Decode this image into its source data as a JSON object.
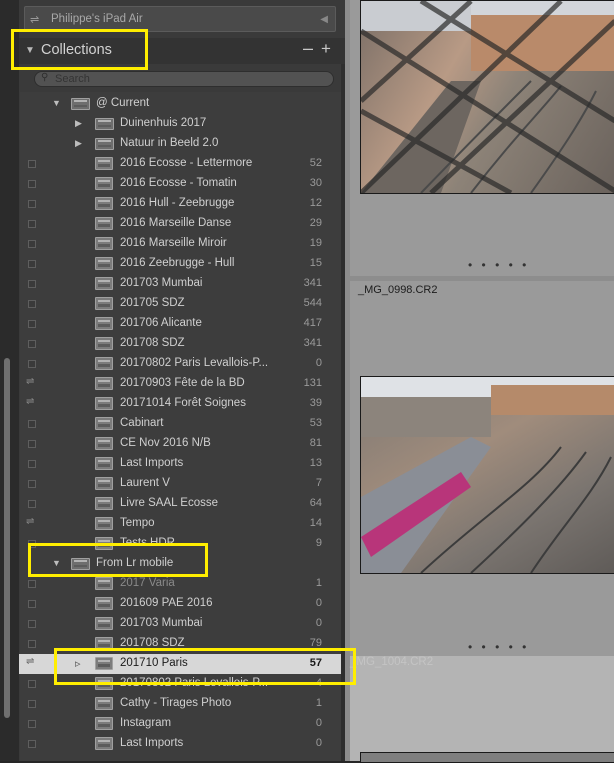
{
  "device": {
    "name": "Philippe's iPad Air"
  },
  "collections_panel": {
    "title": "Collections",
    "search_placeholder": "Search",
    "rows": [
      {
        "label": "@ Current",
        "count": "",
        "type": "set-open",
        "depth": 0
      },
      {
        "label": "Duinenhuis 2017",
        "count": "",
        "type": "set-closed",
        "depth": 1
      },
      {
        "label": "Natuur in Beeld 2.0",
        "count": "",
        "type": "set-closed",
        "depth": 1
      },
      {
        "label": "2016 Ecosse - Lettermore",
        "count": "52",
        "type": "coll",
        "depth": 1
      },
      {
        "label": "2016 Ecosse - Tomatin",
        "count": "30",
        "type": "coll",
        "depth": 1
      },
      {
        "label": "2016 Hull - Zeebrugge",
        "count": "12",
        "type": "coll",
        "depth": 1
      },
      {
        "label": "2016 Marseille Danse",
        "count": "29",
        "type": "coll",
        "depth": 1
      },
      {
        "label": "2016 Marseille Miroir",
        "count": "19",
        "type": "coll",
        "depth": 1
      },
      {
        "label": "2016 Zeebrugge - Hull",
        "count": "15",
        "type": "coll",
        "depth": 1
      },
      {
        "label": "201703 Mumbai",
        "count": "341",
        "type": "coll",
        "depth": 1
      },
      {
        "label": "201705 SDZ",
        "count": "544",
        "type": "coll",
        "depth": 1
      },
      {
        "label": "201706 Alicante",
        "count": "417",
        "type": "coll",
        "depth": 1
      },
      {
        "label": "201708 SDZ",
        "count": "341",
        "type": "coll",
        "depth": 1
      },
      {
        "label": "20170802 Paris Levallois-P...",
        "count": "0",
        "type": "coll",
        "depth": 1
      },
      {
        "label": "20170903 Fête de la BD",
        "count": "131",
        "type": "coll-sync",
        "depth": 1
      },
      {
        "label": "20171014 Forêt Soignes",
        "count": "39",
        "type": "coll-sync",
        "depth": 1
      },
      {
        "label": "Cabinart",
        "count": "53",
        "type": "coll",
        "depth": 1
      },
      {
        "label": "CE Nov 2016 N/B",
        "count": "81",
        "type": "coll",
        "depth": 1
      },
      {
        "label": "Last Imports",
        "count": "13",
        "type": "coll",
        "depth": 1
      },
      {
        "label": "Laurent V",
        "count": "7",
        "type": "coll",
        "depth": 1
      },
      {
        "label": "Livre SAAL Ecosse",
        "count": "64",
        "type": "coll",
        "depth": 1
      },
      {
        "label": "Tempo",
        "count": "14",
        "type": "coll-sync",
        "depth": 1
      },
      {
        "label": "Tests HDR",
        "count": "9",
        "type": "coll",
        "depth": 1
      },
      {
        "label": "From Lr mobile",
        "count": "",
        "type": "set-open",
        "depth": 0
      },
      {
        "label": "2017 Varia",
        "count": "1",
        "type": "coll-dim",
        "depth": 1
      },
      {
        "label": "201609 PAE 2016",
        "count": "0",
        "type": "coll",
        "depth": 1
      },
      {
        "label": "201703 Mumbai",
        "count": "0",
        "type": "coll",
        "depth": 1
      },
      {
        "label": "201708 SDZ",
        "count": "79",
        "type": "coll",
        "depth": 1
      },
      {
        "label": "201710 Paris",
        "count": "57",
        "type": "selected",
        "depth": 1
      },
      {
        "label": "20170802 Paris Levallois-P...",
        "count": "4",
        "type": "coll",
        "depth": 1
      },
      {
        "label": "Cathy - Tirages Photo",
        "count": "1",
        "type": "coll",
        "depth": 1
      },
      {
        "label": "Instagram",
        "count": "0",
        "type": "coll",
        "depth": 1
      },
      {
        "label": "Last Imports",
        "count": "0",
        "type": "coll",
        "depth": 1
      }
    ]
  },
  "grid": {
    "cells": [
      {
        "filename": "_MG_0998.CR2"
      },
      {
        "filename": "_MG_1004.CR2"
      }
    ],
    "dots": "• • • • •"
  },
  "colors": {
    "highlight_box": "#ffee00",
    "selected_row": "#d7d7d7",
    "panel_bg": "#3d3d3d",
    "grid_bg": "#9a9a9a"
  }
}
